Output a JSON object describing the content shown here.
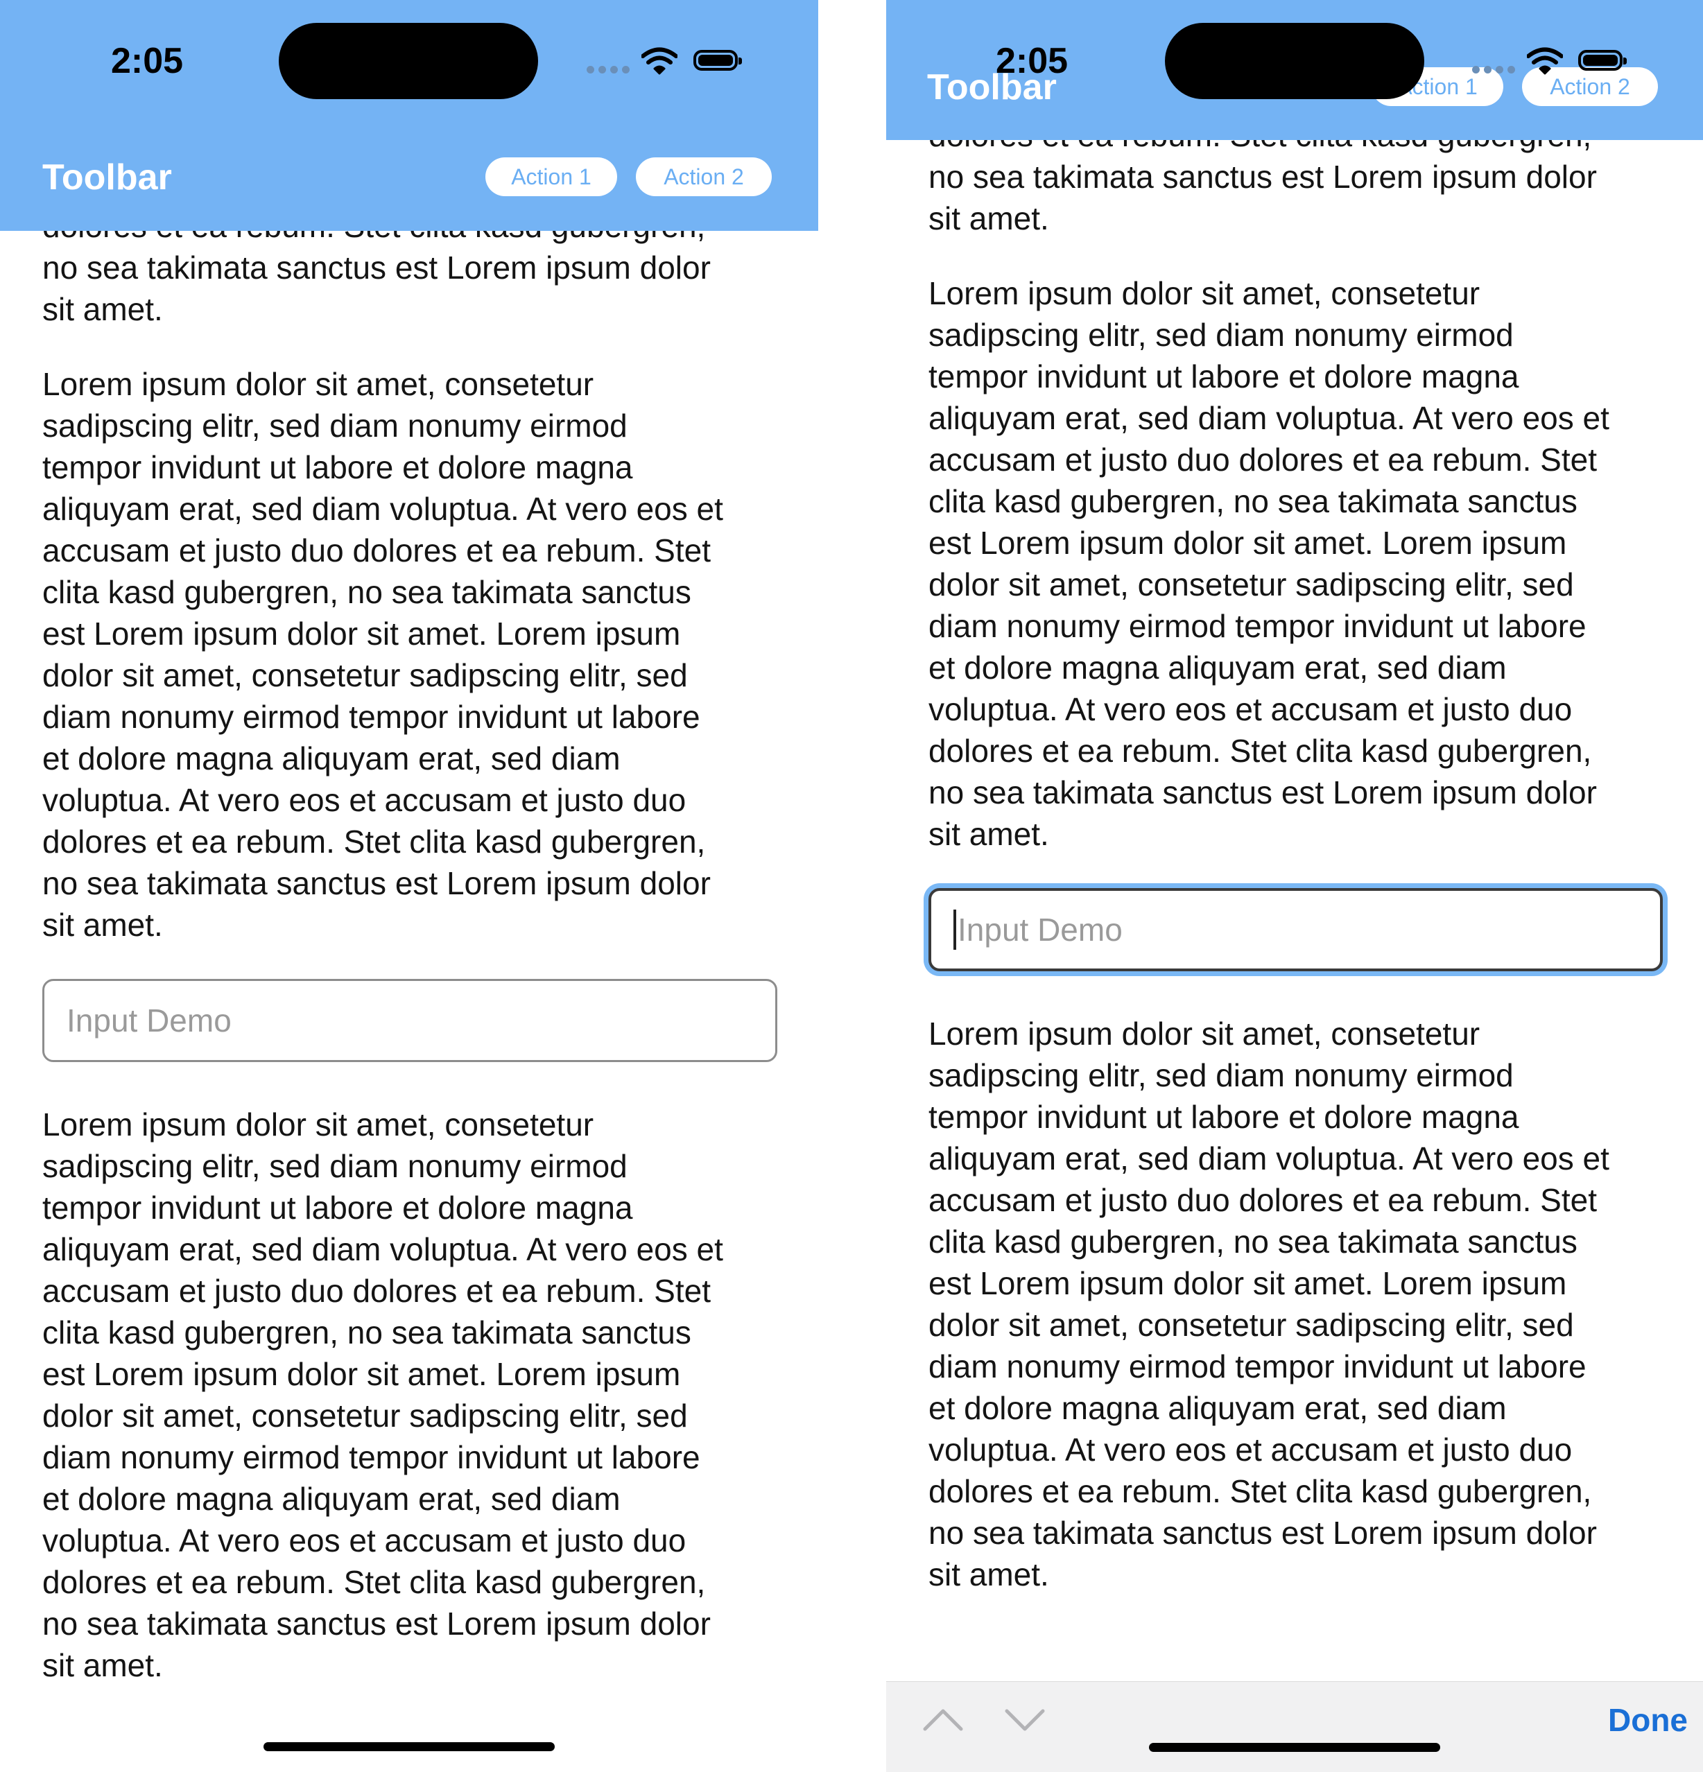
{
  "status_bar": {
    "time": "2:05"
  },
  "toolbar": {
    "title": "Toolbar",
    "action1_label": "Action 1",
    "action2_label": "Action 2"
  },
  "content": {
    "paragraph_top_partial": "dolores et ea rebum. Stet clita kasd gubergren,\nno sea takimata sanctus est Lorem ipsum dolor\nsit amet.",
    "paragraph_main": "Lorem ipsum dolor sit amet, consetetur\nsadipscing elitr, sed diam nonumy eirmod\ntempor invidunt ut labore et dolore magna\naliquyam erat, sed diam voluptua. At vero eos et\naccusam et justo duo dolores et ea rebum. Stet\nclita kasd gubergren, no sea takimata sanctus\nest Lorem ipsum dolor sit amet. Lorem ipsum\ndolor sit amet, consetetur sadipscing elitr, sed\ndiam nonumy eirmod tempor invidunt ut labore\net dolore magna aliquyam erat, sed diam\nvoluptua. At vero eos et accusam et justo duo\ndolores et ea rebum. Stet clita kasd gubergren,\nno sea takimata sanctus est Lorem ipsum dolor\nsit amet.",
    "input_placeholder": "Input Demo"
  },
  "keyboard_accessory": {
    "done_label": "Done",
    "icons": [
      "chevron-up-icon",
      "chevron-down-icon"
    ]
  },
  "colors": {
    "toolbar_bg": "#74b3f4",
    "action_text": "#6aaef3",
    "focus_ring": "#7ab8f5",
    "done": "#1a6fd6"
  }
}
